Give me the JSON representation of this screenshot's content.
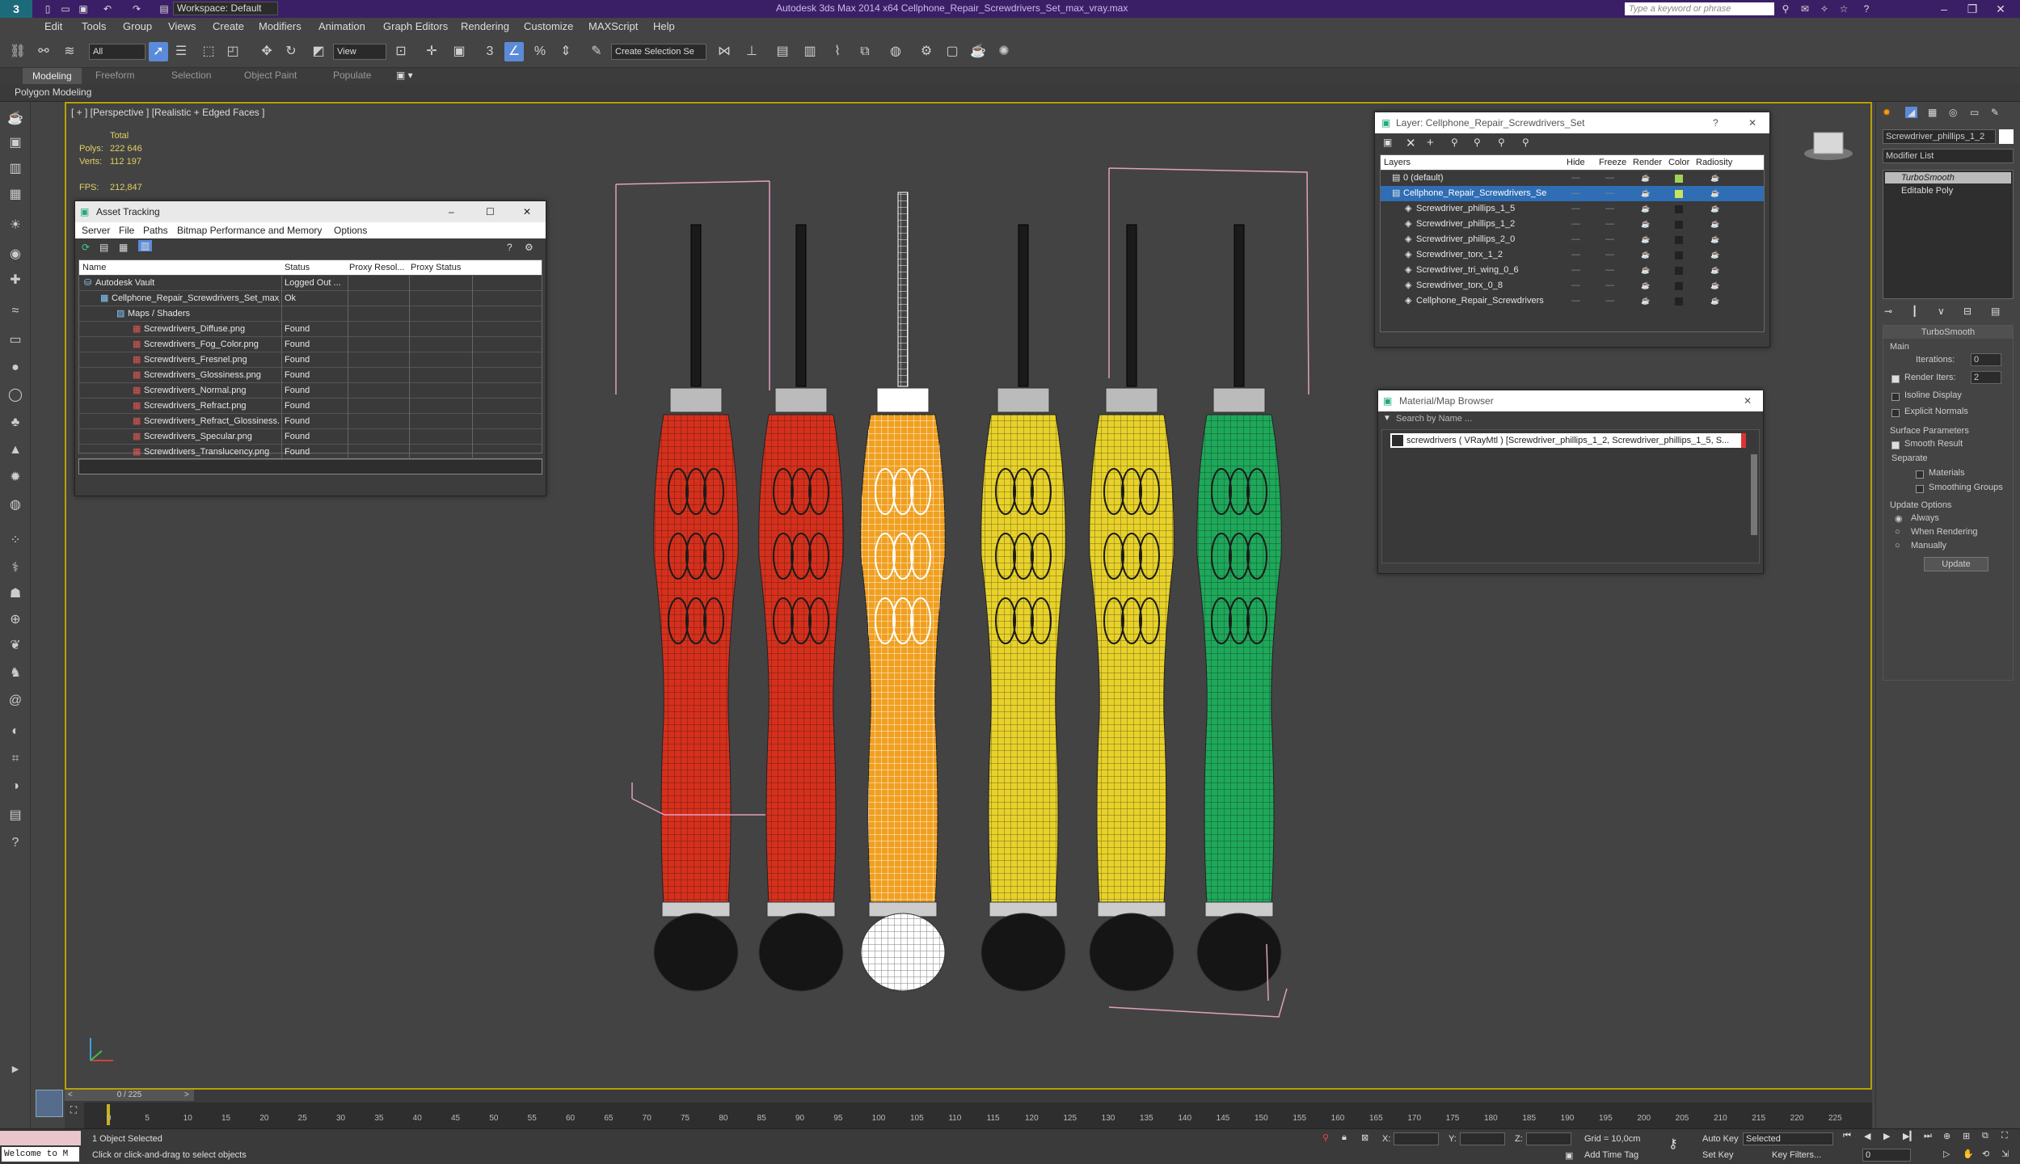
{
  "app": {
    "title": "Autodesk 3ds Max 2014 x64     Cellphone_Repair_Screwdrivers_Set_max_vray.max",
    "workspace": "Workspace: Default",
    "search_placeholder": "Type a keyword or phrase"
  },
  "menubar": [
    "Edit",
    "Tools",
    "Group",
    "Views",
    "Create",
    "Modifiers",
    "Animation",
    "Graph Editors",
    "Rendering",
    "Customize",
    "MAXScript",
    "Help"
  ],
  "toolbar": {
    "selection_filter": "All",
    "ref_coord": "View",
    "named_selection": "Create Selection Se"
  },
  "ribbon": {
    "tabs": [
      "Modeling",
      "Freeform",
      "Selection",
      "Object Paint",
      "Populate"
    ],
    "active_tab": "Modeling",
    "sub_label": "Polygon Modeling"
  },
  "viewport": {
    "label": "[ + ] [Perspective ] [Realistic + Edged Faces ]",
    "stats": {
      "total_label": "Total",
      "polys_label": "Polys:",
      "polys": "222 646",
      "verts_label": "Verts:",
      "verts": "112 197",
      "fps_label": "FPS:",
      "fps": "212,847"
    }
  },
  "asset_tracking": {
    "title": "Asset Tracking",
    "menu": [
      "Server",
      "File",
      "Paths",
      "Bitmap Performance and Memory",
      "Options"
    ],
    "columns": [
      "Name",
      "Status",
      "Proxy Resol...",
      "Proxy Status"
    ],
    "rows": [
      {
        "name": "Autodesk Vault",
        "status": "Logged Out ..."
      },
      {
        "name": "Cellphone_Repair_Screwdrivers_Set_max_...",
        "status": "Ok"
      },
      {
        "name": "Maps / Shaders",
        "status": ""
      },
      {
        "name": "Screwdrivers_Diffuse.png",
        "status": "Found"
      },
      {
        "name": "Screwdrivers_Fog_Color.png",
        "status": "Found"
      },
      {
        "name": "Screwdrivers_Fresnel.png",
        "status": "Found"
      },
      {
        "name": "Screwdrivers_Glossiness.png",
        "status": "Found"
      },
      {
        "name": "Screwdrivers_Normal.png",
        "status": "Found"
      },
      {
        "name": "Screwdrivers_Refract.png",
        "status": "Found"
      },
      {
        "name": "Screwdrivers_Refract_Glossiness.png",
        "status": "Found"
      },
      {
        "name": "Screwdrivers_Specular.png",
        "status": "Found"
      },
      {
        "name": "Screwdrivers_Translucency.png",
        "status": "Found"
      }
    ]
  },
  "layer_panel": {
    "title": "Layer: Cellphone_Repair_Screwdrivers_Set",
    "columns": [
      "Layers",
      "Hide",
      "Freeze",
      "Render",
      "Color",
      "Radiosity"
    ],
    "rows": [
      {
        "name": "0 (default)",
        "color": "#9fd25a"
      },
      {
        "name": "Cellphone_Repair_Screwdrivers_Se",
        "color": "#c8e65a"
      },
      {
        "name": "Screwdriver_phillips_1_5",
        "color": "#222222"
      },
      {
        "name": "Screwdriver_phillips_1_2",
        "color": "#222222"
      },
      {
        "name": "Screwdriver_phillips_2_0",
        "color": "#222222"
      },
      {
        "name": "Screwdriver_torx_1_2",
        "color": "#222222"
      },
      {
        "name": "Screwdriver_tri_wing_0_6",
        "color": "#222222"
      },
      {
        "name": "Screwdriver_torx_0_8",
        "color": "#222222"
      },
      {
        "name": "Cellphone_Repair_Screwdrivers",
        "color": "#222222"
      }
    ]
  },
  "material_browser": {
    "title": "Material/Map Browser",
    "search_placeholder": "Search by Name ...",
    "item": "screwdrivers  ( VRayMtl ) [Screwdriver_phillips_1_2, Screwdriver_phillips_1_5, S..."
  },
  "command_panel": {
    "object_name": "Screwdriver_phillips_1_2",
    "modifier_list": "Modifier List",
    "stack": [
      "TurboSmooth",
      "Editable Poly"
    ],
    "rollout_title": "TurboSmooth",
    "main_label": "Main",
    "iterations_label": "Iterations:",
    "iterations": "0",
    "render_iters_label": "Render Iters:",
    "render_iters": "2",
    "isoline": "Isoline Display",
    "explicit": "Explicit Normals",
    "surface_label": "Surface Parameters",
    "smooth_result": "Smooth Result",
    "separate": "Separate",
    "materials": "Materials",
    "smoothing_groups": "Smoothing Groups",
    "update_options": "Update Options",
    "always": "Always",
    "when_rendering": "When Rendering",
    "manually": "Manually",
    "update_button": "Update"
  },
  "timeline": {
    "frame": "0 / 225",
    "ticks": [
      "0",
      "5",
      "10",
      "15",
      "20",
      "25",
      "30",
      "35",
      "40",
      "45",
      "50",
      "55",
      "60",
      "65",
      "70",
      "75",
      "80",
      "85",
      "90",
      "95",
      "100",
      "105",
      "110",
      "115",
      "120",
      "125",
      "130",
      "135",
      "140",
      "145",
      "150",
      "155",
      "160",
      "165",
      "170",
      "175",
      "180",
      "185",
      "190",
      "195",
      "200",
      "205",
      "210",
      "215",
      "220",
      "225"
    ]
  },
  "statusbar": {
    "maxscript": "Welcome to M",
    "selected": "1 Object Selected",
    "prompt": "Click or click-and-drag to select objects",
    "x_label": "X:",
    "y_label": "Y:",
    "z_label": "Z:",
    "grid": "Grid = 10,0cm",
    "add_time_tag": "Add Time Tag",
    "auto_key": "Auto Key",
    "set_key": "Set Key",
    "selected_combo": "Selected",
    "key_filters": "Key Filters...",
    "frame_field": "0"
  },
  "screwdrivers": [
    {
      "color": "#d6301c"
    },
    {
      "color": "#d6301c"
    },
    {
      "color": "#f0a020"
    },
    {
      "color": "#e8d22a"
    },
    {
      "color": "#e8d22a"
    },
    {
      "color": "#1ea85a"
    }
  ]
}
